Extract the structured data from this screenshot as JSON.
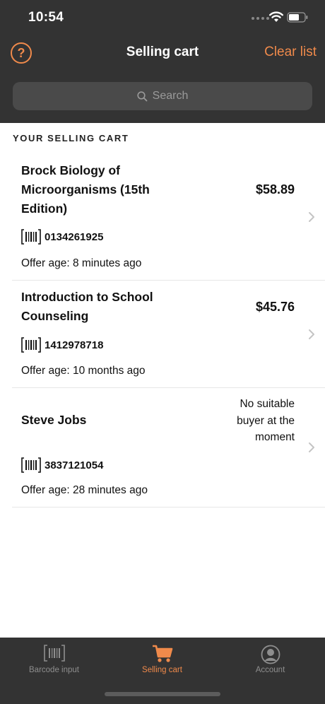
{
  "status_bar": {
    "time": "10:54"
  },
  "nav": {
    "title": "Selling cart",
    "clear_label": "Clear list",
    "help_label": "?"
  },
  "search": {
    "placeholder": "Search"
  },
  "section": {
    "title": "YOUR SELLING CART"
  },
  "items": [
    {
      "title": "Brock Biology of Microorganisms (15th Edition)",
      "price": "$58.89",
      "isbn": "0134261925",
      "age": "Offer age: 8 minutes ago"
    },
    {
      "title": "Introduction to School Counseling",
      "price": "$45.76",
      "isbn": "1412978718",
      "age": "Offer age: 10 months ago"
    },
    {
      "title": "Steve Jobs",
      "note": "No suitable buyer at the moment",
      "isbn": "3837121054",
      "age": "Offer age: 28 minutes ago"
    }
  ],
  "tabs": [
    {
      "label": "Barcode input",
      "icon": "barcode-icon"
    },
    {
      "label": "Selling cart",
      "icon": "cart-icon",
      "active": true
    },
    {
      "label": "Account",
      "icon": "account-icon"
    }
  ],
  "colors": {
    "accent": "#f08a4b",
    "header_bg": "#333333",
    "tab_bg": "#333333"
  }
}
